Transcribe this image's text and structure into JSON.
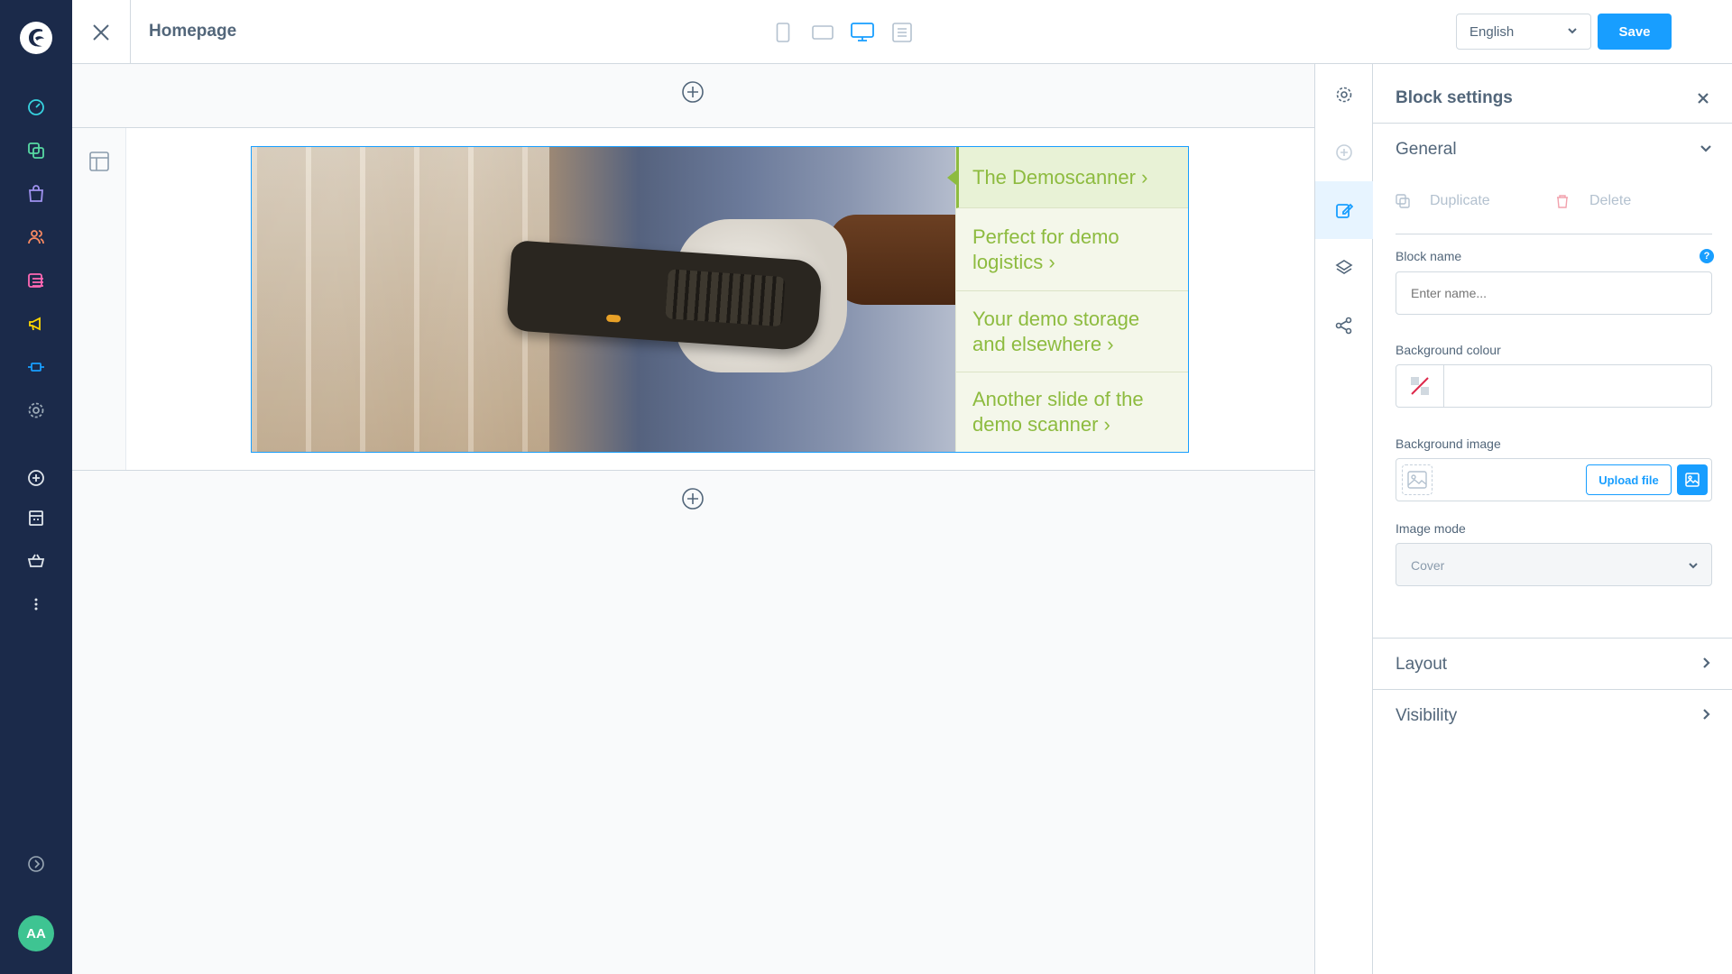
{
  "app": {
    "avatar_initials": "AA",
    "nav_icons": [
      "dashboard-icon",
      "catalog-icon",
      "orders-icon",
      "customers-icon",
      "content-icon",
      "marketing-icon",
      "extensions-icon",
      "settings-icon",
      "add-icon",
      "sales-channel-icon",
      "basket-icon",
      "more-icon",
      "expand-icon"
    ]
  },
  "topbar": {
    "title": "Homepage",
    "language": "English",
    "save_label": "Save",
    "viewports": [
      "mobile",
      "tablet",
      "desktop",
      "form"
    ],
    "active_viewport": "desktop"
  },
  "block": {
    "image_alt": "Gloved hand holding a handheld barcode scanner in a warehouse",
    "slides": [
      "The Demoscanner ›",
      "Perfect for demo logistics ›",
      "Your demo storage and elsewhere ›",
      "Another slide of the demo scanner ›"
    ],
    "active_slide": 0
  },
  "toolstrip": {
    "tools": [
      "settings-icon",
      "add-block-icon",
      "edit-icon",
      "layers-icon",
      "share-icon"
    ],
    "active_tool": "edit-icon"
  },
  "panel": {
    "title": "Block settings",
    "general_label": "General",
    "duplicate_label": "Duplicate",
    "delete_label": "Delete",
    "block_name_label": "Block name",
    "block_name_placeholder": "Enter name...",
    "help_label": "?",
    "bg_colour_label": "Background colour",
    "bg_image_label": "Background image",
    "upload_label": "Upload file",
    "image_mode_label": "Image mode",
    "image_mode_value": "Cover",
    "layout_label": "Layout",
    "visibility_label": "Visibility"
  },
  "colors": {
    "nav_bg": "#1b2a4a",
    "accent": "#189eff",
    "slide_text": "#8dbb3f",
    "avatar": "#3ec492"
  }
}
